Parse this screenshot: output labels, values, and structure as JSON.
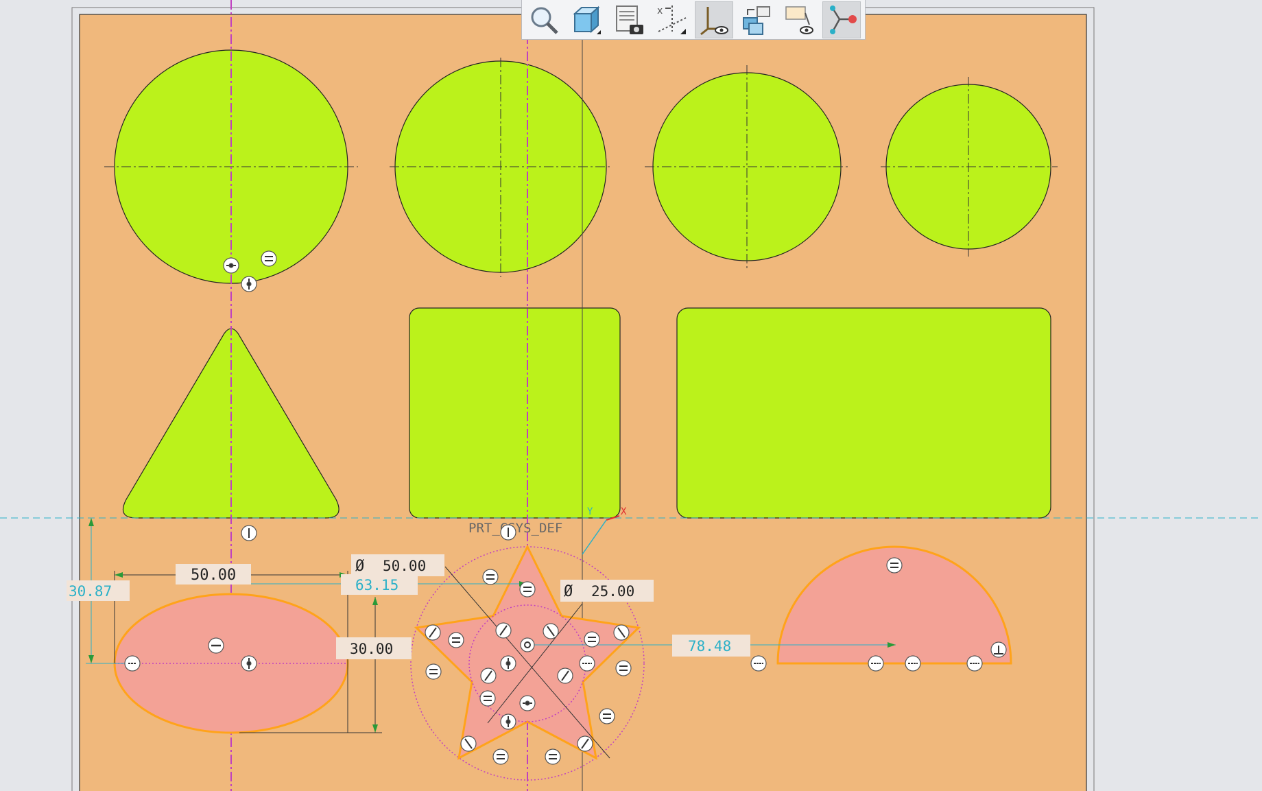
{
  "toolbar": {
    "buttons": [
      {
        "name": "refit-zoom-button",
        "icon": "magnifier-icon",
        "active": false
      },
      {
        "name": "display-style-button",
        "icon": "cube-icon",
        "active": false
      },
      {
        "name": "saved-views-button",
        "icon": "sheet-camera-icon",
        "active": false
      },
      {
        "name": "datum-display-button",
        "icon": "datum-axes-icon",
        "active": false
      },
      {
        "name": "csys-display-button",
        "icon": "coordinate-system-icon",
        "active": true
      },
      {
        "name": "spin-center-button",
        "icon": "view-manager-icon",
        "active": false
      },
      {
        "name": "annotation-display-button",
        "icon": "annotation-eye-icon",
        "active": false
      },
      {
        "name": "sketch-display-button",
        "icon": "sketch-nodes-icon",
        "active": true
      }
    ]
  },
  "sketch": {
    "csys_label": "PRT_CSYS_DEF",
    "axis_y_label": "Y",
    "axis_x_label": "X"
  },
  "dimensions": {
    "ellipse_width": "50.00",
    "ellipse_height": "30.00",
    "vertical_offset": "30.87",
    "outer_diameter_symbol": "Ø",
    "outer_diameter": "50.00",
    "center_distance": "63.15",
    "inner_diameter_symbol": "Ø",
    "inner_diameter": "25.00",
    "semicircle_distance": "78.48"
  },
  "colors": {
    "background": "#e4e6ea",
    "sheet": "#f0b87c",
    "shape_fill": "#bbf21b",
    "sketch_fill": "#f3a296",
    "sketch_outline": "#ffa31a",
    "centerline": "#c040c0",
    "weak_dimension": "#2ab0c8",
    "strong_dimension": "#222222"
  }
}
